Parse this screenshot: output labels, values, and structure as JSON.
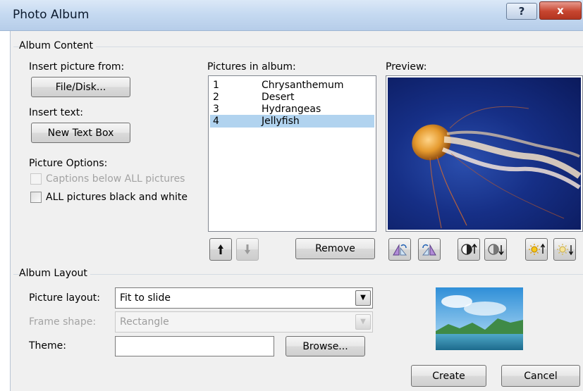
{
  "window": {
    "title": "Photo Album",
    "help_glyph": "?",
    "close_glyph": "x"
  },
  "album_content": {
    "group_label": "Album Content",
    "insert_picture_from_label": "Insert picture from:",
    "file_disk_button": "File/Disk...",
    "insert_text_label": "Insert text:",
    "new_text_box_button": "New Text Box",
    "picture_options_label": "Picture Options:",
    "captions_checkbox": {
      "label": "Captions below ALL pictures",
      "checked": false,
      "enabled": false
    },
    "black_white_checkbox": {
      "label": "ALL pictures black and white",
      "checked": false,
      "enabled": true
    },
    "pictures_in_album_label": "Pictures in album:",
    "pictures": [
      {
        "num": "1",
        "name": "Chrysanthemum",
        "selected": false
      },
      {
        "num": "2",
        "name": "Desert",
        "selected": false
      },
      {
        "num": "3",
        "name": "Hydrangeas",
        "selected": false
      },
      {
        "num": "4",
        "name": "Jellyfish",
        "selected": true
      }
    ],
    "move_up_icon": "arrow-up-icon",
    "move_down_icon": "arrow-down-icon",
    "remove_button": "Remove",
    "preview_label": "Preview:",
    "preview_tools": [
      "rotate-left-icon",
      "rotate-right-icon",
      "contrast-increase-icon",
      "contrast-decrease-icon",
      "brightness-increase-icon",
      "brightness-decrease-icon"
    ]
  },
  "album_layout": {
    "group_label": "Album Layout",
    "picture_layout_label": "Picture layout:",
    "picture_layout_value": "Fit to slide",
    "frame_shape_label": "Frame shape:",
    "frame_shape_value": "Rectangle",
    "theme_label": "Theme:",
    "theme_value": "",
    "browse_button": "Browse..."
  },
  "footer": {
    "create_button": "Create",
    "cancel_button": "Cancel"
  },
  "colors": {
    "selection": "#b1d3ef",
    "titlebar": "#c6daf1",
    "close_red": "#c7452f",
    "dialog_bg": "#f0f0f0"
  }
}
